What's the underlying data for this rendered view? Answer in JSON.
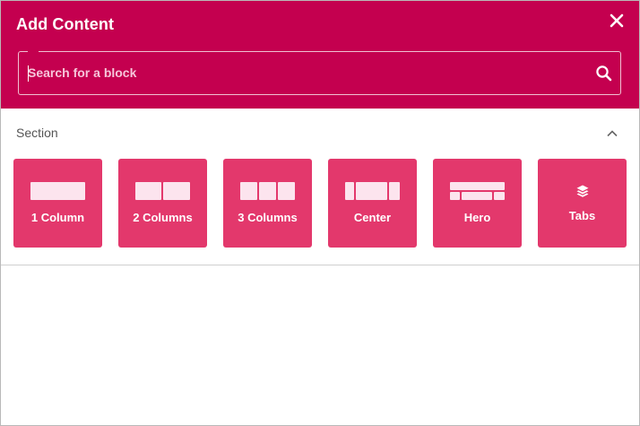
{
  "dialog": {
    "title": "Add Content",
    "close_icon": "close-icon"
  },
  "search": {
    "placeholder": "Search for a block",
    "value": "",
    "icon": "search-icon"
  },
  "section": {
    "label": "Section",
    "collapse_icon": "chevron-up-icon",
    "tiles": [
      {
        "label": "1 Column",
        "icon": "one-column-icon"
      },
      {
        "label": "2 Columns",
        "icon": "two-columns-icon"
      },
      {
        "label": "3 Columns",
        "icon": "three-columns-icon"
      },
      {
        "label": "Center",
        "icon": "center-icon"
      },
      {
        "label": "Hero",
        "icon": "hero-icon"
      },
      {
        "label": "Tabs",
        "icon": "layers-icon"
      }
    ]
  },
  "colors": {
    "header": "#c4004f",
    "tile": "#e3386c"
  }
}
